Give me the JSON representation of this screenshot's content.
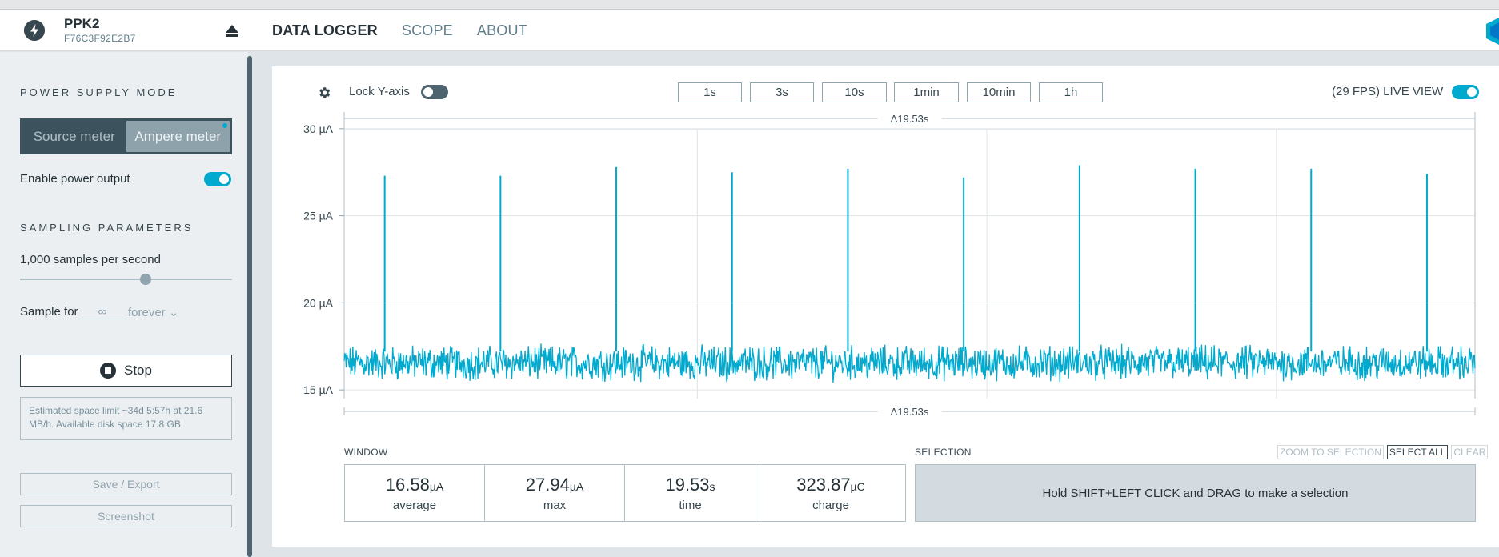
{
  "header": {
    "device_name": "PPK2",
    "device_serial": "F76C3F92E2B7",
    "tabs": [
      {
        "label": "DATA LOGGER",
        "active": true
      },
      {
        "label": "SCOPE",
        "active": false
      },
      {
        "label": "ABOUT",
        "active": false
      }
    ],
    "icons": [
      "power-bolt-icon",
      "eject-icon",
      "brand-logo-icon"
    ]
  },
  "sidebar": {
    "power_supply_title": "POWER SUPPLY MODE",
    "modes": [
      {
        "label": "Source meter",
        "active": false
      },
      {
        "label": "Ampere meter",
        "active": true
      }
    ],
    "enable_power_output": {
      "label": "Enable power output",
      "on": true
    },
    "sampling_title": "SAMPLING PARAMETERS",
    "sample_rate_label": "1,000 samples per second",
    "sample_rate_slider_fraction": 0.6,
    "sample_for_label": "Sample for",
    "sample_for_value": "∞",
    "sample_for_unit": "forever",
    "stop_label": "Stop",
    "space_note": "Estimated space limit ~34d 5:57h at 21.6 MB/h. Available disk space 17.8 GB",
    "save_export_label": "Save / Export",
    "screenshot_label": "Screenshot"
  },
  "toolbar": {
    "lock_y_label": "Lock Y-axis",
    "lock_y_on": false,
    "windows": [
      "1s",
      "3s",
      "10s",
      "1min",
      "10min",
      "1h"
    ],
    "live_view_label": "(29 FPS) LIVE VIEW",
    "live_view_on": true
  },
  "chart_data": {
    "type": "line",
    "title": "",
    "xlabel": "",
    "ylabel": "",
    "y_unit": "µA",
    "ylim": [
      14.5,
      30.5
    ],
    "y_ticks": [
      {
        "value": 30,
        "label": "30 µA"
      },
      {
        "value": 25,
        "label": "25 µA"
      },
      {
        "value": 20,
        "label": "20 µA"
      },
      {
        "value": 15,
        "label": "15 µA"
      }
    ],
    "x_range_s": [
      0,
      19.53
    ],
    "window_delta_label": "Δ19.53s",
    "baseline_mean": 16.58,
    "noise_range": [
      15.4,
      17.7
    ],
    "spikes": [
      {
        "t": 0.7,
        "value": 27.3
      },
      {
        "t": 2.7,
        "value": 27.3
      },
      {
        "t": 4.7,
        "value": 27.8
      },
      {
        "t": 6.7,
        "value": 27.5
      },
      {
        "t": 8.7,
        "value": 27.7
      },
      {
        "t": 10.7,
        "value": 27.2
      },
      {
        "t": 12.7,
        "value": 27.9
      },
      {
        "t": 14.7,
        "value": 27.7
      },
      {
        "t": 16.7,
        "value": 27.7
      },
      {
        "t": 18.7,
        "value": 27.4
      }
    ],
    "vertical_gridlines_s": [
      6.1,
      11.1,
      16.1
    ],
    "grid": true,
    "legend": "none",
    "color": "#00a9ce"
  },
  "window_stats": {
    "title": "WINDOW",
    "stats": [
      {
        "value": "16.58",
        "unit": "µA",
        "label": "average"
      },
      {
        "value": "27.94",
        "unit": "µA",
        "label": "max"
      },
      {
        "value": "19.53",
        "unit": "s",
        "label": "time"
      },
      {
        "value": "323.87",
        "unit": "µC",
        "label": "charge"
      }
    ]
  },
  "selection": {
    "title": "SELECTION",
    "actions": [
      {
        "label": "ZOOM TO SELECTION",
        "enabled": false
      },
      {
        "label": "SELECT ALL",
        "enabled": true
      },
      {
        "label": "CLEAR",
        "enabled": false
      }
    ],
    "hint": "Hold SHIFT+LEFT CLICK and DRAG to make a selection"
  }
}
